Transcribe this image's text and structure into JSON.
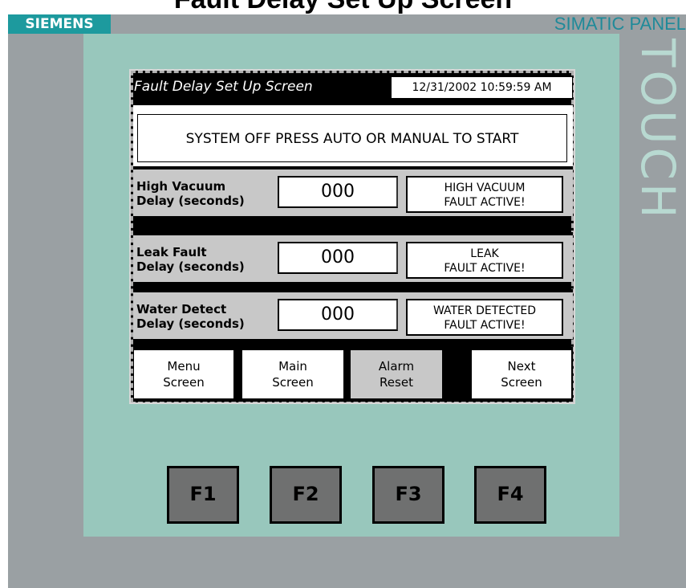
{
  "header_cut_text": "Fault Delay Set Up Screen",
  "device": {
    "brand_logo": "SIEMENS",
    "panel_label": "SIMATIC PANEL",
    "touch_label": "TOUCH",
    "colors": {
      "logo_bg": "#1d9a9e",
      "bezel": "#98c7bc",
      "device_body": "#9aa0a3",
      "screen_frame": "#000000",
      "row_bg": "#c8c8c8"
    }
  },
  "screen": {
    "title": "Fault Delay Set Up Screen",
    "datetime": "12/31/2002 10:59:59 AM",
    "status_message": "SYSTEM OFF PRESS AUTO OR MANUAL TO START",
    "rows": [
      {
        "label_line1": "High Vacuum",
        "label_line2": "Delay (seconds)",
        "value": "000",
        "fault_line1": "HIGH VACUUM",
        "fault_line2": "FAULT ACTIVE!"
      },
      {
        "label_line1": "Leak Fault",
        "label_line2": "Delay (seconds)",
        "value": "000",
        "fault_line1": "LEAK",
        "fault_line2": "FAULT ACTIVE!"
      },
      {
        "label_line1": "Water Detect",
        "label_line2": "Delay (seconds)",
        "value": "000",
        "fault_line1": "WATER DETECTED",
        "fault_line2": "FAULT ACTIVE!"
      }
    ],
    "nav": [
      {
        "line1": "Menu",
        "line2": "Screen"
      },
      {
        "line1": "Main",
        "line2": "Screen"
      },
      {
        "line1": "Alarm",
        "line2": "Reset"
      },
      {
        "line1": "Next",
        "line2": "Screen"
      }
    ]
  },
  "function_keys": [
    "F1",
    "F2",
    "F3",
    "F4"
  ]
}
